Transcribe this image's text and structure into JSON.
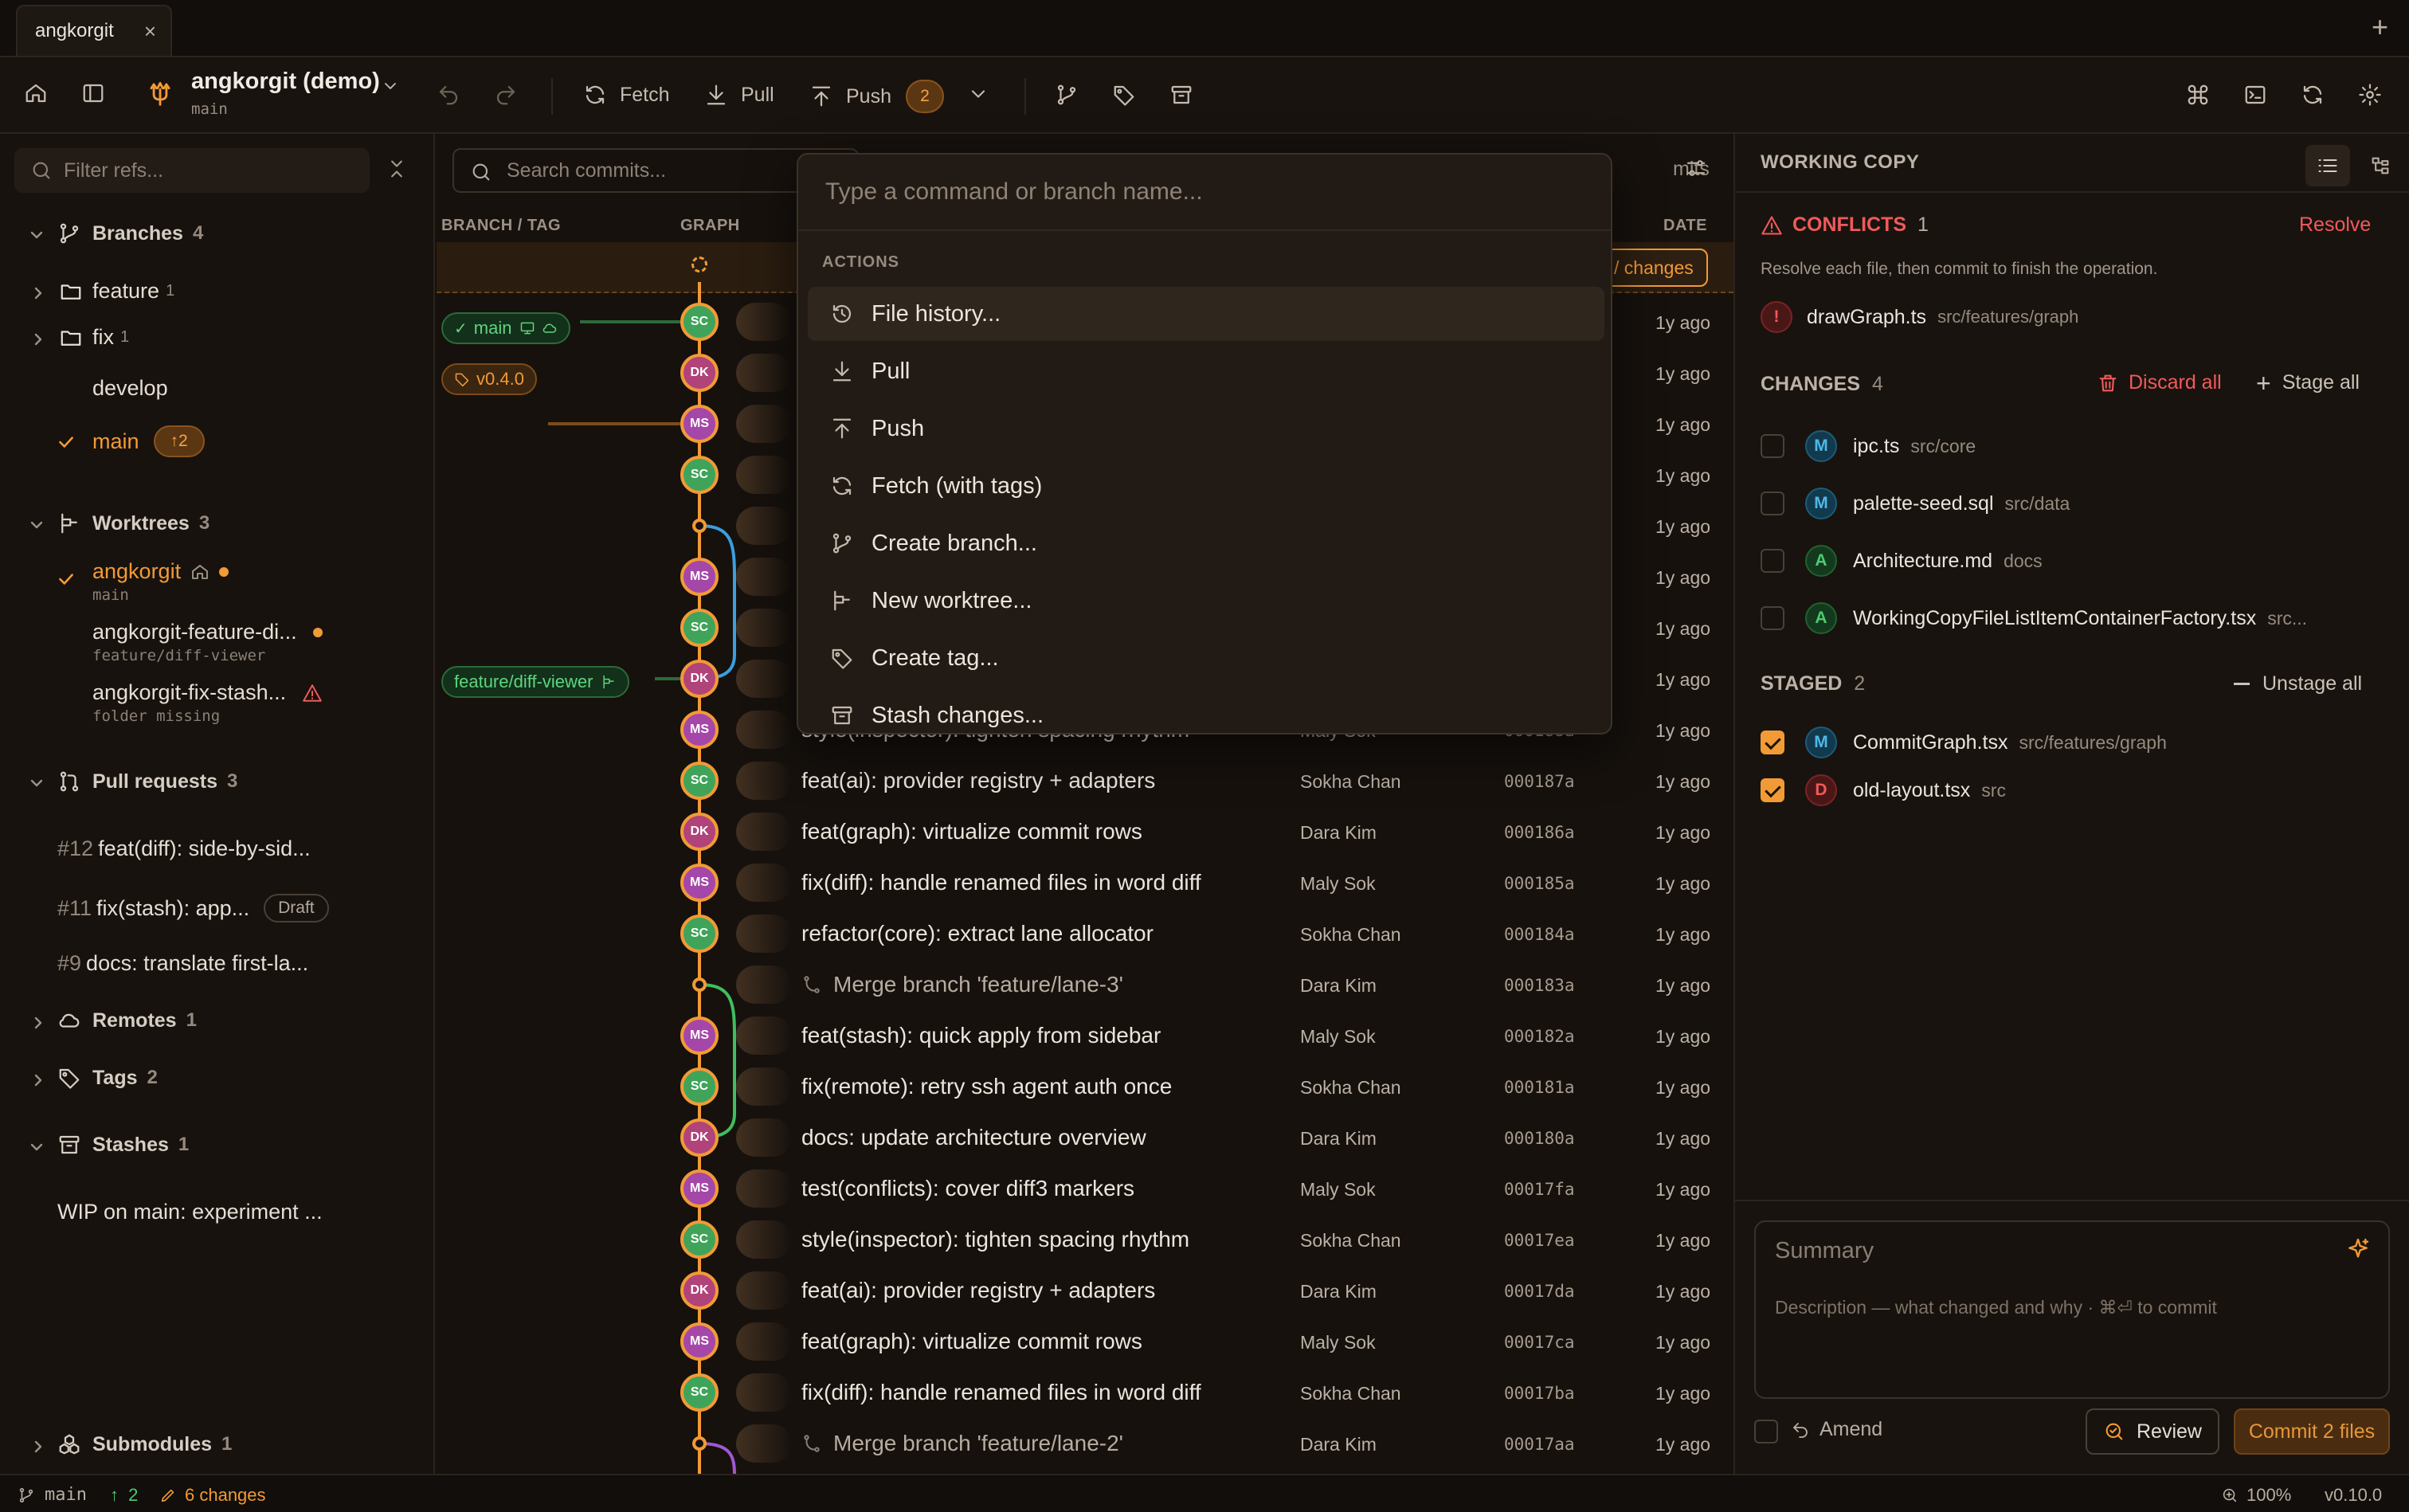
{
  "tab": {
    "title": "angkorgit",
    "close": "×",
    "add": "+"
  },
  "toolbar": {
    "repo_name": "angkorgit (demo)",
    "repo_branch": "main",
    "fetch": "Fetch",
    "pull": "Pull",
    "push": "Push",
    "push_count": "2"
  },
  "sidebar": {
    "filter_placeholder": "Filter refs...",
    "branches": {
      "label": "Branches",
      "count": "4"
    },
    "feature": {
      "label": "feature",
      "count": "1"
    },
    "fix": {
      "label": "fix",
      "count": "1"
    },
    "develop": "develop",
    "main": {
      "label": "main",
      "ahead": "↑2"
    },
    "worktrees": {
      "label": "Worktrees",
      "count": "3"
    },
    "wt": [
      {
        "name": "angkorgit",
        "branch": "main"
      },
      {
        "name": "angkorgit-feature-di...",
        "branch": "feature/diff-viewer"
      },
      {
        "name": "angkorgit-fix-stash...",
        "branch": "folder missing"
      }
    ],
    "pull_requests": {
      "label": "Pull requests",
      "count": "3"
    },
    "prs": [
      {
        "num": "#12",
        "title": "feat(diff): side-by-sid..."
      },
      {
        "num": "#11",
        "title": "fix(stash): app...",
        "badge": "Draft"
      },
      {
        "num": "#9",
        "title": "docs: translate first-la..."
      }
    ],
    "remotes": {
      "label": "Remotes",
      "count": "1"
    },
    "tags": {
      "label": "Tags",
      "count": "2"
    },
    "stashes": {
      "label": "Stashes",
      "count": "1"
    },
    "stash_item": "WIP on main: experiment ...",
    "submodules": {
      "label": "Submodules",
      "count": "1"
    }
  },
  "main": {
    "search_placeholder": "Search commits...",
    "mits_text": "mits",
    "col_branch": "BRANCH / TAG",
    "col_graph": "GRAPH",
    "col_date": "DATE",
    "changes_btn": "/ changes",
    "refs": {
      "main": "main",
      "tag": "v0.4.0",
      "feature": "feature/diff-viewer"
    },
    "rows": [
      {
        "i": "SC",
        "c": "#3fa45a",
        "s": "",
        "a": "",
        "h": "",
        "d": "1y ago"
      },
      {
        "i": "DK",
        "c": "#b0437a",
        "s": "",
        "a": "",
        "h": "",
        "d": "1y ago"
      },
      {
        "i": "MS",
        "c": "#a447a8",
        "s": "",
        "a": "",
        "h": "",
        "d": "1y ago"
      },
      {
        "i": "SC",
        "c": "#3fa45a",
        "s": "",
        "a": "",
        "h": "",
        "d": "1y ago"
      },
      {
        "i": "",
        "c": "",
        "s": "",
        "a": "",
        "h": "",
        "d": "1y ago",
        "merge": true
      },
      {
        "i": "MS",
        "c": "#a447a8",
        "s": "",
        "a": "",
        "h": "",
        "d": "1y ago"
      },
      {
        "i": "SC",
        "c": "#3fa45a",
        "s": "",
        "a": "",
        "h": "",
        "d": "1y ago"
      },
      {
        "i": "DK",
        "c": "#b0437a",
        "s": "",
        "a": "",
        "h": "",
        "d": "1y ago"
      },
      {
        "i": "MS",
        "c": "#a447a8",
        "s": "style(inspector): tighten spacing rhythm",
        "a": "Maly Sok",
        "h": "000188a",
        "d": "1y ago"
      },
      {
        "i": "SC",
        "c": "#3fa45a",
        "s": "feat(ai): provider registry + adapters",
        "a": "Sokha Chan",
        "h": "000187a",
        "d": "1y ago"
      },
      {
        "i": "DK",
        "c": "#b0437a",
        "s": "feat(graph): virtualize commit rows",
        "a": "Dara Kim",
        "h": "000186a",
        "d": "1y ago"
      },
      {
        "i": "MS",
        "c": "#a447a8",
        "s": "fix(diff): handle renamed files in word diff",
        "a": "Maly Sok",
        "h": "000185a",
        "d": "1y ago"
      },
      {
        "i": "SC",
        "c": "#3fa45a",
        "s": "refactor(core): extract lane allocator",
        "a": "Sokha Chan",
        "h": "000184a",
        "d": "1y ago"
      },
      {
        "i": "",
        "c": "",
        "s": "Merge branch 'feature/lane-3'",
        "a": "Dara Kim",
        "h": "000183a",
        "d": "1y ago",
        "merge": true
      },
      {
        "i": "MS",
        "c": "#a447a8",
        "s": "feat(stash): quick apply from sidebar",
        "a": "Maly Sok",
        "h": "000182a",
        "d": "1y ago"
      },
      {
        "i": "SC",
        "c": "#3fa45a",
        "s": "fix(remote): retry ssh agent auth once",
        "a": "Sokha Chan",
        "h": "000181a",
        "d": "1y ago"
      },
      {
        "i": "DK",
        "c": "#b0437a",
        "s": "docs: update architecture overview",
        "a": "Dara Kim",
        "h": "000180a",
        "d": "1y ago"
      },
      {
        "i": "MS",
        "c": "#a447a8",
        "s": "test(conflicts): cover diff3 markers",
        "a": "Maly Sok",
        "h": "00017fa",
        "d": "1y ago"
      },
      {
        "i": "SC",
        "c": "#3fa45a",
        "s": "style(inspector): tighten spacing rhythm",
        "a": "Sokha Chan",
        "h": "00017ea",
        "d": "1y ago"
      },
      {
        "i": "DK",
        "c": "#b0437a",
        "s": "feat(ai): provider registry + adapters",
        "a": "Dara Kim",
        "h": "00017da",
        "d": "1y ago"
      },
      {
        "i": "MS",
        "c": "#a447a8",
        "s": "feat(graph): virtualize commit rows",
        "a": "Maly Sok",
        "h": "00017ca",
        "d": "1y ago"
      },
      {
        "i": "SC",
        "c": "#3fa45a",
        "s": "fix(diff): handle renamed files in word diff",
        "a": "Sokha Chan",
        "h": "00017ba",
        "d": "1y ago"
      },
      {
        "i": "",
        "c": "",
        "s": "Merge branch 'feature/lane-2'",
        "a": "Dara Kim",
        "h": "00017aa",
        "d": "1y ago",
        "merge": true
      }
    ]
  },
  "palette": {
    "placeholder": "Type a command or branch name...",
    "group": "ACTIONS",
    "items": [
      {
        "label": "File history...",
        "icon": "history-icon"
      },
      {
        "label": "Pull",
        "icon": "pull-icon"
      },
      {
        "label": "Push",
        "icon": "push-icon"
      },
      {
        "label": "Fetch (with tags)",
        "icon": "fetch-icon"
      },
      {
        "label": "Create branch...",
        "icon": "branch-icon"
      },
      {
        "label": "New worktree...",
        "icon": "worktree-icon"
      },
      {
        "label": "Create tag...",
        "icon": "tag-icon"
      },
      {
        "label": "Stash changes...",
        "icon": "stash-icon"
      }
    ]
  },
  "right": {
    "title": "WORKING COPY",
    "conflicts": {
      "label": "CONFLICTS",
      "count": "1",
      "resolve": "Resolve",
      "hint": "Resolve each file, then commit to finish the operation."
    },
    "conflict_file": {
      "name": "drawGraph.ts",
      "path": "src/features/graph",
      "status": "!"
    },
    "changes": {
      "label": "CHANGES",
      "count": "4",
      "discard": "Discard all",
      "stage": "Stage all"
    },
    "change_files": [
      {
        "s": "M",
        "name": "ipc.ts",
        "path": "src/core"
      },
      {
        "s": "M",
        "name": "palette-seed.sql",
        "path": "src/data"
      },
      {
        "s": "A",
        "name": "Architecture.md",
        "path": "docs"
      },
      {
        "s": "A",
        "name": "WorkingCopyFileListItemContainerFactory.tsx",
        "path": "src..."
      }
    ],
    "staged": {
      "label": "STAGED",
      "count": "2",
      "unstage": "Unstage all"
    },
    "staged_files": [
      {
        "s": "M",
        "name": "CommitGraph.tsx",
        "path": "src/features/graph"
      },
      {
        "s": "D",
        "name": "old-layout.tsx",
        "path": "src"
      }
    ],
    "summary_placeholder": "Summary",
    "desc_placeholder": "Description — what changed and why  ·  ⌘⏎ to commit",
    "amend": "Amend",
    "review": "Review",
    "commit": "Commit 2 files"
  },
  "status": {
    "branch": "main",
    "ahead": "2",
    "changes": "6 changes",
    "zoom": "100%",
    "version": "v0.10.0"
  },
  "colors": {
    "accent": "#f29a36",
    "danger": "#f05a5a",
    "green": "#4ecb73",
    "blue": "#4fb8ea",
    "purple": "#a447a8",
    "pink": "#b0437a"
  }
}
